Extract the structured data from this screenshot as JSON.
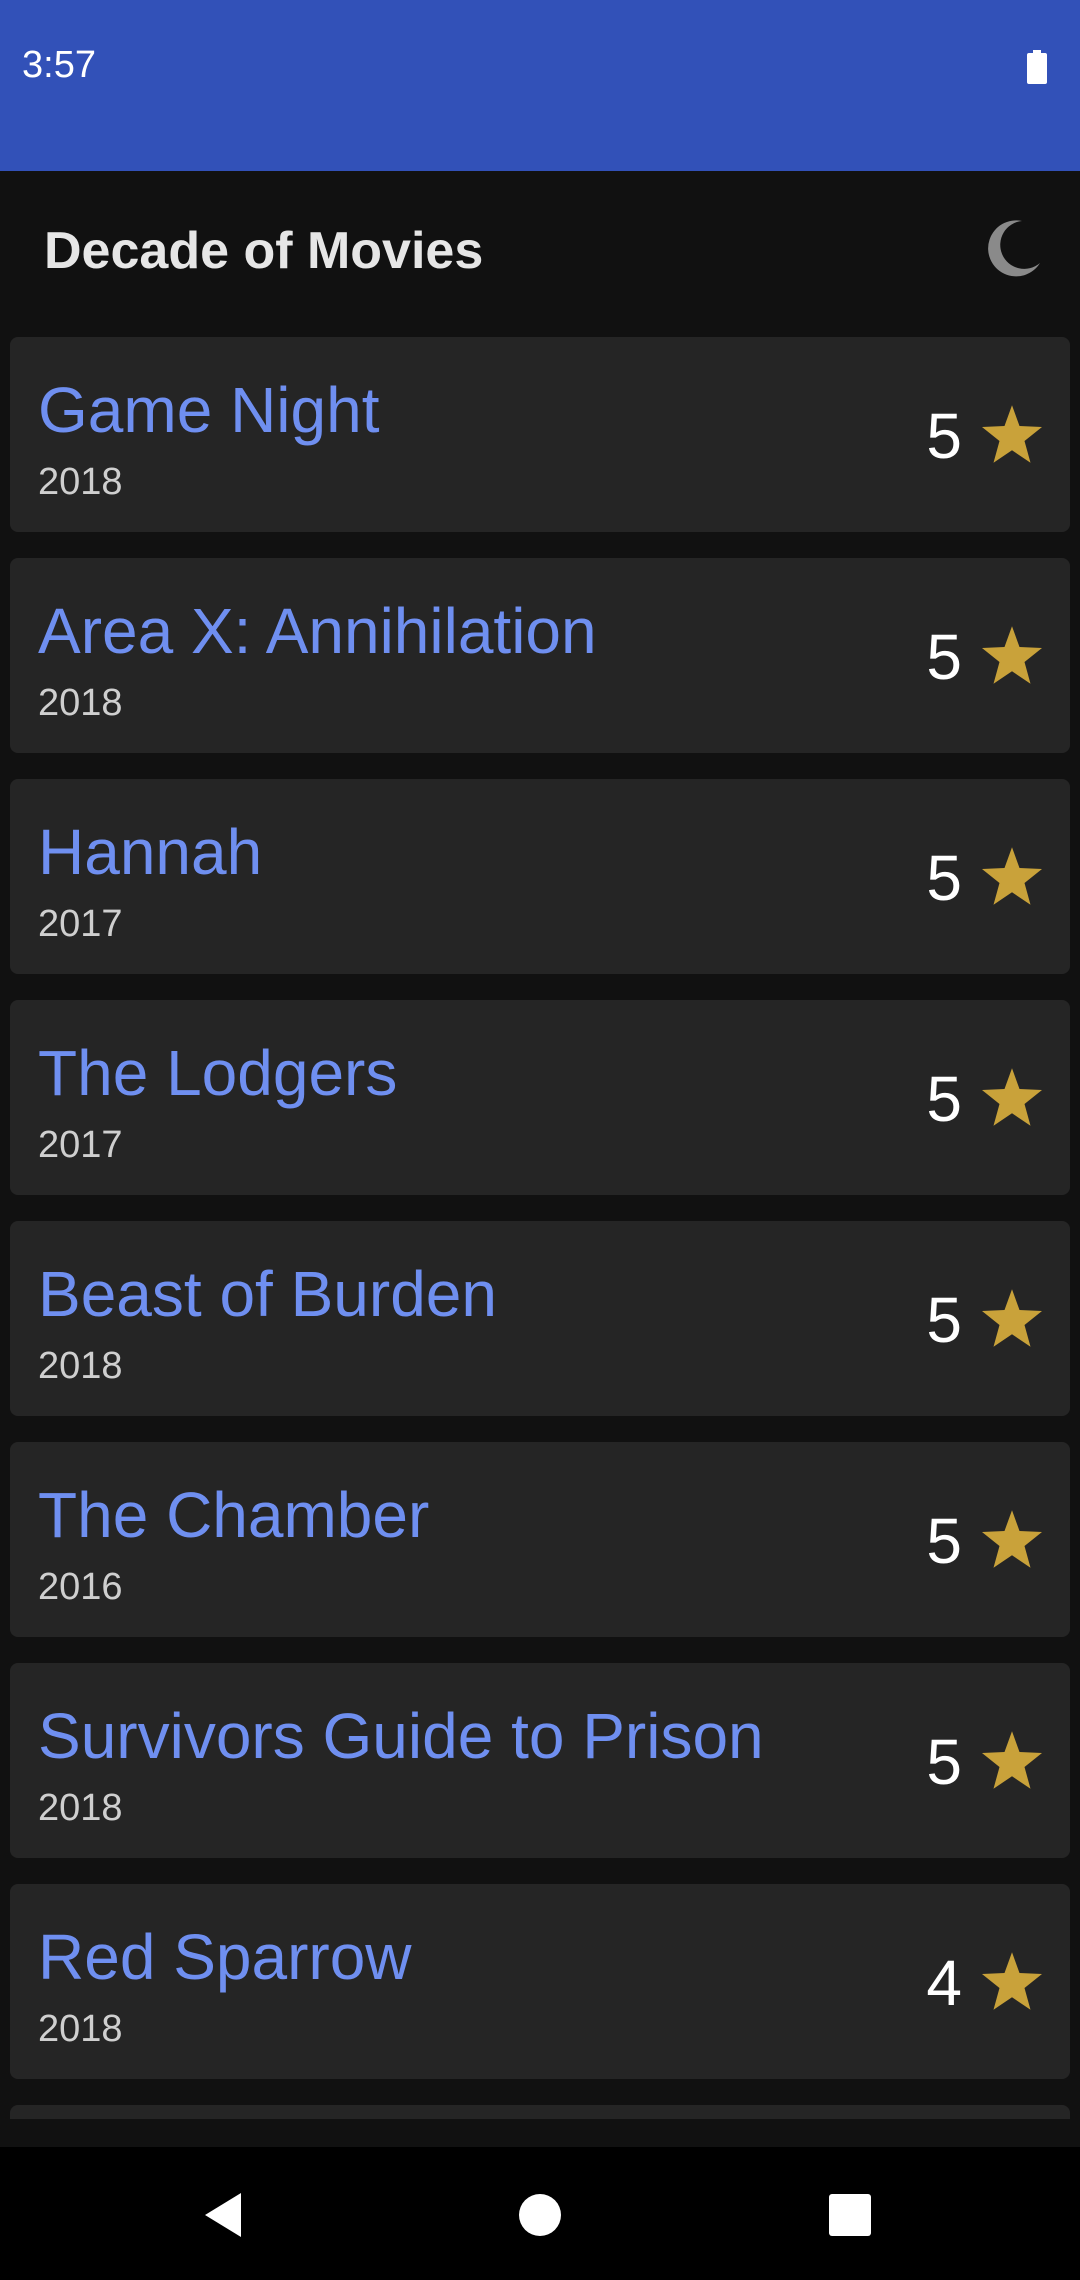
{
  "status": {
    "time": "3:57"
  },
  "app": {
    "title": "Decade of Movies"
  },
  "icons": {
    "theme_toggle": "moon-icon",
    "rating": "star-icon",
    "battery": "battery-icon",
    "nav_back": "back-triangle-icon",
    "nav_home": "home-circle-icon",
    "nav_recents": "recents-square-icon"
  },
  "colors": {
    "status_bar": "#3251b8",
    "background": "#111111",
    "card": "#252525",
    "title": "#6f8ff0",
    "star": "#c9a23a"
  },
  "movies": [
    {
      "title": "Game Night",
      "year": "2018",
      "rating": "5"
    },
    {
      "title": "Area X: Annihilation",
      "year": "2018",
      "rating": "5"
    },
    {
      "title": "Hannah",
      "year": "2017",
      "rating": "5"
    },
    {
      "title": "The Lodgers",
      "year": "2017",
      "rating": "5"
    },
    {
      "title": "Beast of Burden",
      "year": "2018",
      "rating": "5"
    },
    {
      "title": "The Chamber",
      "year": "2016",
      "rating": "5"
    },
    {
      "title": "Survivors Guide to Prison",
      "year": "2018",
      "rating": "5"
    },
    {
      "title": "Red Sparrow",
      "year": "2018",
      "rating": "4"
    }
  ]
}
